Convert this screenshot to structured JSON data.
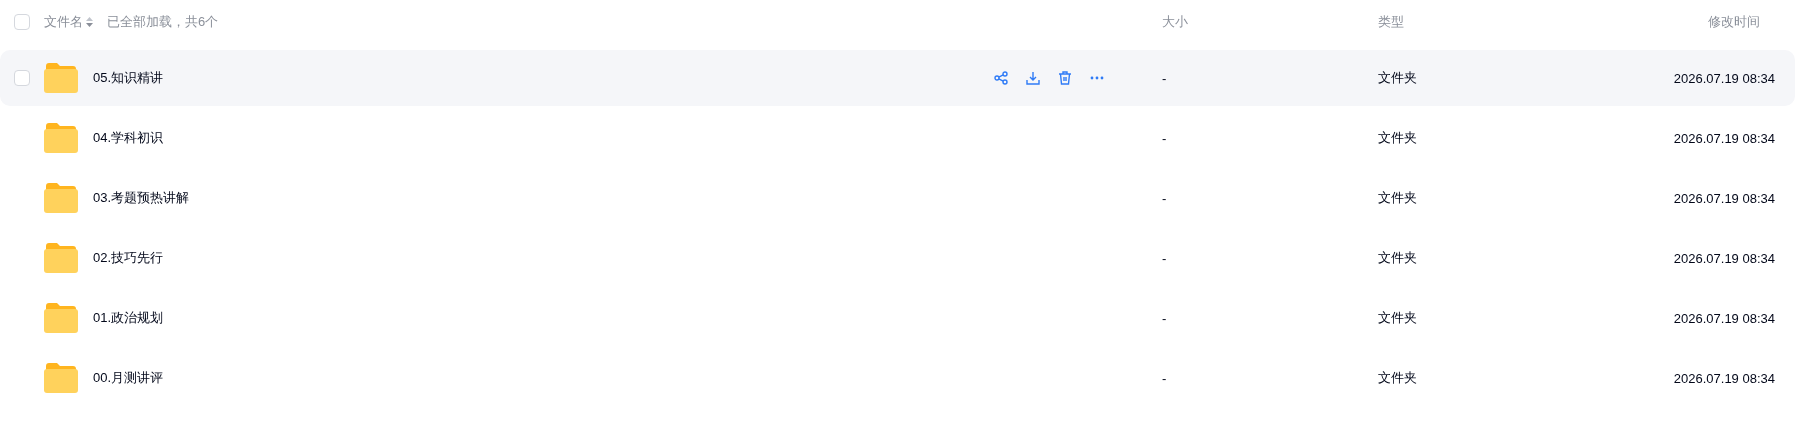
{
  "header": {
    "select_all": {
      "checked": false
    },
    "name_column": "文件名",
    "load_status": "已全部加载，共6个",
    "size_column": "大小",
    "type_column": "类型",
    "modified_column": "修改时间"
  },
  "rows": [
    {
      "name": "05.知识精讲",
      "size": "-",
      "type": "文件夹",
      "modified": "2026.07.19 08:34",
      "hovered": true,
      "checked": false
    },
    {
      "name": "04.学科初识",
      "size": "-",
      "type": "文件夹",
      "modified": "2026.07.19 08:34",
      "hovered": false,
      "checked": false
    },
    {
      "name": "03.考题预热讲解",
      "size": "-",
      "type": "文件夹",
      "modified": "2026.07.19 08:34",
      "hovered": false,
      "checked": false
    },
    {
      "name": "02.技巧先行",
      "size": "-",
      "type": "文件夹",
      "modified": "2026.07.19 08:34",
      "hovered": false,
      "checked": false
    },
    {
      "name": "01.政治规划",
      "size": "-",
      "type": "文件夹",
      "modified": "2026.07.19 08:34",
      "hovered": false,
      "checked": false
    },
    {
      "name": "00.月测讲评",
      "size": "-",
      "type": "文件夹",
      "modified": "2026.07.19 08:34",
      "hovered": false,
      "checked": false
    }
  ]
}
